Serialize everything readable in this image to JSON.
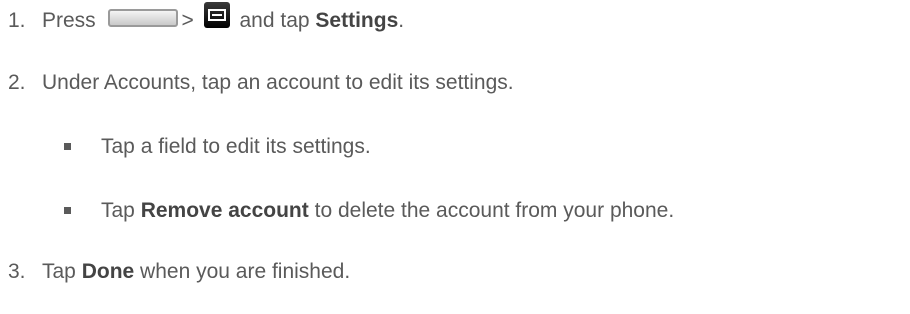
{
  "steps": [
    {
      "number": "1.",
      "press": "Press",
      "gt": ">",
      "and_tap": "and tap",
      "settings": "Settings",
      "period": ".",
      "icons": [
        "home-key-icon",
        "menu-key-icon"
      ]
    },
    {
      "number": "2.",
      "text": "Under Accounts, tap an account to edit its settings."
    },
    {
      "number": "3.",
      "tap": "Tap",
      "done": "Done",
      "rest": "when you are finished."
    }
  ],
  "bullets": [
    {
      "text": "Tap a field to edit its settings."
    },
    {
      "tap": "Tap",
      "remove_account": "Remove account",
      "rest": "to delete the account from your phone."
    }
  ],
  "colors": {
    "text": "#5a5a5a",
    "bold": "#444444",
    "icon_dark": "#1a1a1a"
  }
}
